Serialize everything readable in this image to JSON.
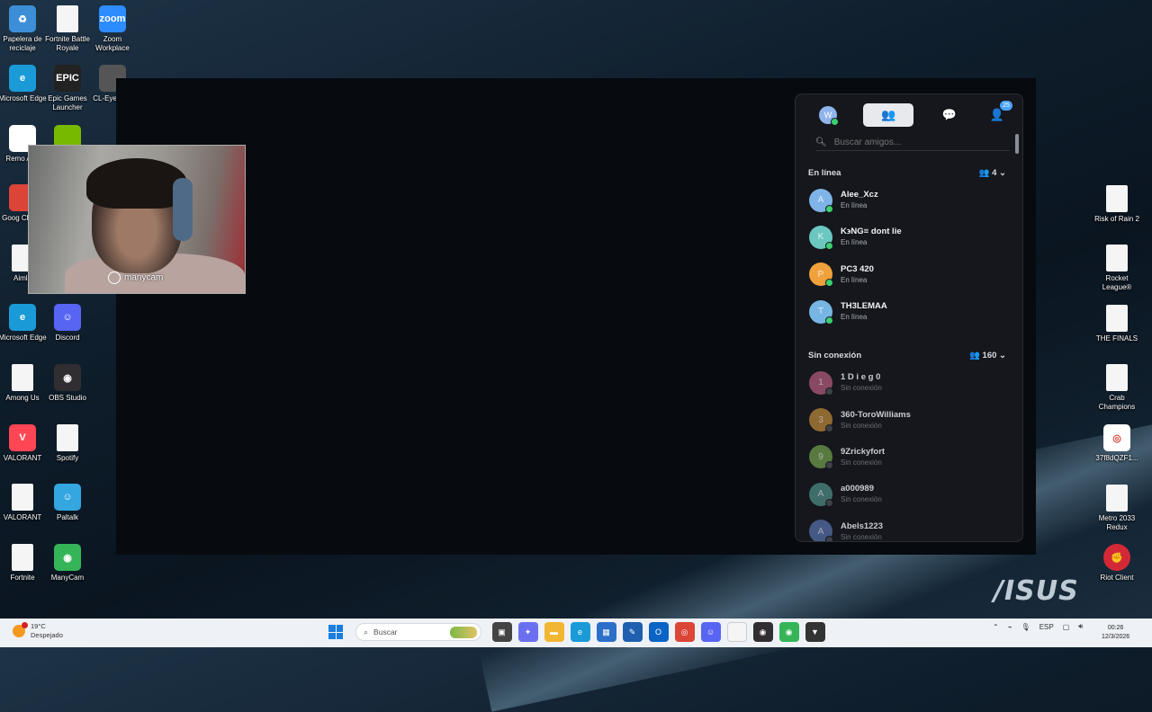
{
  "desktop": {
    "left_icons": [
      {
        "name": "recycle-bin-icon",
        "label": "Papelera de reciclaje",
        "glyph": "♻",
        "color": "#3c8fd6"
      },
      {
        "name": "fortnite-br-icon",
        "label": "Fortnite Battle Royale",
        "glyph": "",
        "color": "#f5f5f5"
      },
      {
        "name": "zoom-icon",
        "label": "Zoom Workplace",
        "glyph": "zoom",
        "color": "#2d8cff"
      },
      {
        "name": "edge-icon",
        "label": "Microsoft Edge",
        "glyph": "e",
        "color": "#1a9bd7"
      },
      {
        "name": "epic-games-icon",
        "label": "Epic Games Launcher",
        "glyph": "EPIC",
        "color": "#222222"
      },
      {
        "name": "cl-eye-icon",
        "label": "CL-Eye Test",
        "glyph": "",
        "color": "#555555"
      },
      {
        "name": "remote-app-icon",
        "label": "Remo App",
        "glyph": "",
        "color": "#ffffff"
      },
      {
        "name": "nvidia-icon",
        "label": "",
        "glyph": "",
        "color": "#76b900"
      },
      {
        "name": "chrome-icon",
        "label": "Goog Chrom",
        "glyph": "",
        "color": "#db4437"
      },
      {
        "name": "aimlab-icon",
        "label": "Aimla",
        "glyph": "",
        "color": "#f5f5f5"
      },
      {
        "name": "edge-icon-2",
        "label": "Microsoft Edge",
        "glyph": "e",
        "color": "#1a9bd7"
      },
      {
        "name": "discord-icon",
        "label": "Discord",
        "glyph": "☺",
        "color": "#5865f2"
      },
      {
        "name": "among-us-icon",
        "label": "Among Us",
        "glyph": "",
        "color": "#f5f5f5"
      },
      {
        "name": "obs-icon",
        "label": "OBS Studio",
        "glyph": "◉",
        "color": "#302e31"
      },
      {
        "name": "valorant-icon",
        "label": "VALORANT",
        "glyph": "V",
        "color": "#ff4655"
      },
      {
        "name": "spotify-icon",
        "label": "Spotify",
        "glyph": "",
        "color": "#f5f5f5"
      },
      {
        "name": "valorant-file-icon",
        "label": "VALORANT",
        "glyph": "",
        "color": "#f5f5f5"
      },
      {
        "name": "paltalk-icon",
        "label": "Paltalk",
        "glyph": "☺",
        "color": "#34a6e0"
      },
      {
        "name": "fortnite-file-icon",
        "label": "Fortnite",
        "glyph": "",
        "color": "#f5f5f5"
      },
      {
        "name": "manycam-icon",
        "label": "ManyCam",
        "glyph": "◉",
        "color": "#35b558"
      }
    ],
    "right_icons": [
      {
        "name": "risk-of-rain-icon",
        "label": "Risk of Rain 2"
      },
      {
        "name": "rocket-league-icon",
        "label": "Rocket League®"
      },
      {
        "name": "the-finals-icon",
        "label": "THE FINALS"
      },
      {
        "name": "crab-champions-icon",
        "label": "Crab Champions"
      },
      {
        "name": "chrome-shortcut-icon",
        "label": "37f8dQZF1..."
      },
      {
        "name": "metro-2033-icon",
        "label": "Metro 2033 Redux"
      },
      {
        "name": "riot-client-icon",
        "label": "Riot Client"
      }
    ],
    "brand": "/ISUS"
  },
  "webcam": {
    "watermark": "manycam"
  },
  "friends": {
    "tabs": {
      "profile_initial": "W",
      "notifications_badge": "25"
    },
    "search": {
      "placeholder": "Buscar amigos..."
    },
    "online_section": {
      "title": "En línea",
      "count": "4"
    },
    "offline_section": {
      "title": "Sin conexión",
      "count": "160"
    },
    "online": [
      {
        "initial": "A",
        "name": "Alee_Xcz",
        "status": "En línea",
        "color": "#7fb4e8"
      },
      {
        "initial": "K",
        "name": "K϶NG≡ dont lie",
        "status": "En línea",
        "color": "#6cc7c1"
      },
      {
        "initial": "P",
        "name": "PC3 420",
        "status": "En línea",
        "color": "#f0a13c"
      },
      {
        "initial": "T",
        "name": "TH3LEMAA",
        "status": "En línea",
        "color": "#77b5e3"
      }
    ],
    "offline": [
      {
        "initial": "1",
        "name": "1 D i e g 0",
        "status": "Sin conexión",
        "color": "#b25a7a"
      },
      {
        "initial": "3",
        "name": "360-ToroWilliams",
        "status": "Sin conexión",
        "color": "#b8853a"
      },
      {
        "initial": "9",
        "name": "9Zrickyfort",
        "status": "Sin conexión",
        "color": "#6f9a4c"
      },
      {
        "initial": "A",
        "name": "a000989",
        "status": "Sin conexión",
        "color": "#4e8c84"
      },
      {
        "initial": "A",
        "name": "Abels1223",
        "status": "Sin conexión",
        "color": "#5471a6"
      }
    ],
    "status_colors": {
      "online": "#3bd16f",
      "offline": "#4a4f57"
    }
  },
  "taskbar": {
    "weather_temp": "19°C",
    "weather_desc": "Despejado",
    "search_label": "Buscar",
    "apps": [
      {
        "name": "task-view-icon",
        "color": "#444444",
        "glyph": "▣"
      },
      {
        "name": "copilot-icon",
        "color": "#6a6ff0",
        "glyph": "✦"
      },
      {
        "name": "file-explorer-icon",
        "color": "#f2b632",
        "glyph": "▬"
      },
      {
        "name": "edge-taskbar-icon",
        "color": "#1a9bd7",
        "glyph": "e"
      },
      {
        "name": "store-icon",
        "color": "#2b6fc9",
        "glyph": "▦"
      },
      {
        "name": "snip-icon",
        "color": "#1f5fb0",
        "glyph": "✎"
      },
      {
        "name": "outlook-icon",
        "color": "#0a64c4",
        "glyph": "O"
      },
      {
        "name": "chrome-taskbar-icon",
        "color": "#db4437",
        "glyph": "◎"
      },
      {
        "name": "discord-taskbar-icon",
        "color": "#5865f2",
        "glyph": "☺"
      },
      {
        "name": "file-taskbar-icon",
        "color": "#f5f5f5",
        "glyph": ""
      },
      {
        "name": "obs-taskbar-icon",
        "color": "#302e31",
        "glyph": "◉"
      },
      {
        "name": "manycam-taskbar-icon",
        "color": "#35b558",
        "glyph": "◉"
      },
      {
        "name": "epic-taskbar-icon",
        "color": "#333333",
        "glyph": "▼"
      }
    ],
    "language": "ESP",
    "time": "00:26",
    "date": "12/3/2026"
  }
}
